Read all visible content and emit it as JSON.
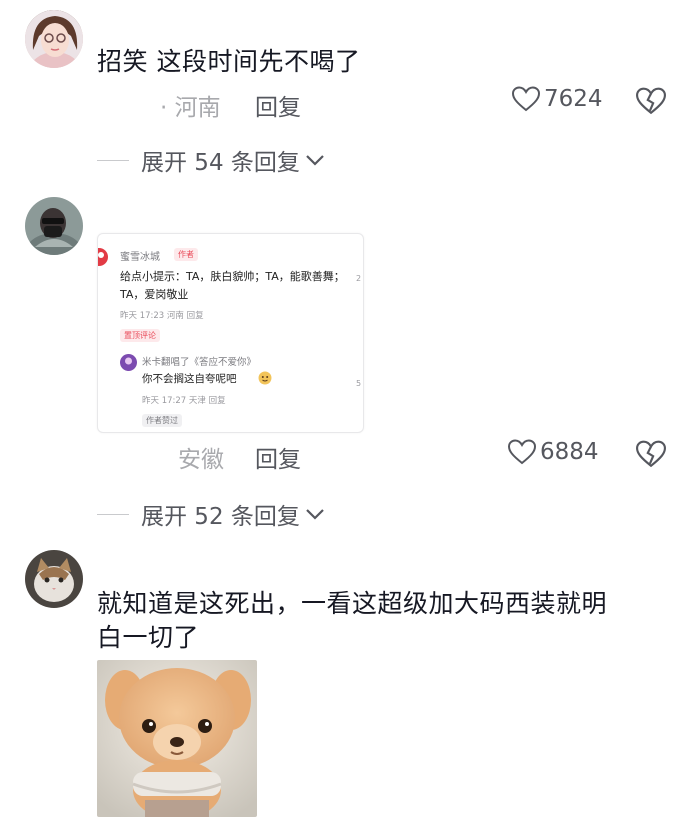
{
  "comments": [
    {
      "text": "招笑 这段时间先不喝了",
      "location": "· 河南",
      "reply_label": "回复",
      "likes": "7624",
      "expand_label": "展开 54 条回复"
    },
    {
      "location": "安徽",
      "reply_label": "回复",
      "likes": "6884",
      "expand_label": "展开 52 条回复",
      "embedded": {
        "username": "蜜雪冰城",
        "author_badge": "作者",
        "body": "给点小提示：TA，肤白貌帅；TA，能歌善舞；TA，爱岗敬业",
        "meta": "昨天 17:23 河南 回复",
        "pinned_label": "置顶评论",
        "sub_username": "米卡翻唱了《答应不爱你》",
        "sub_body": "你不会搁这自夸呢吧",
        "sub_meta": "昨天 17:27 天津 回复",
        "author_liked_label": "作者赞过",
        "side_char_1": "2",
        "side_char_2": "5"
      }
    },
    {
      "text_line1": "就知道是这死出，一看这超级加大码西装就明",
      "text_line2": "白一切了"
    }
  ],
  "colors": {
    "text_primary": "#161823",
    "text_secondary": "#55575e",
    "text_meta": "#a8a9ad",
    "accent_red": "#e94b5a"
  },
  "icons": [
    "heart-outline-icon",
    "broken-heart-icon",
    "chevron-down-icon",
    "brand-logo-icon"
  ]
}
